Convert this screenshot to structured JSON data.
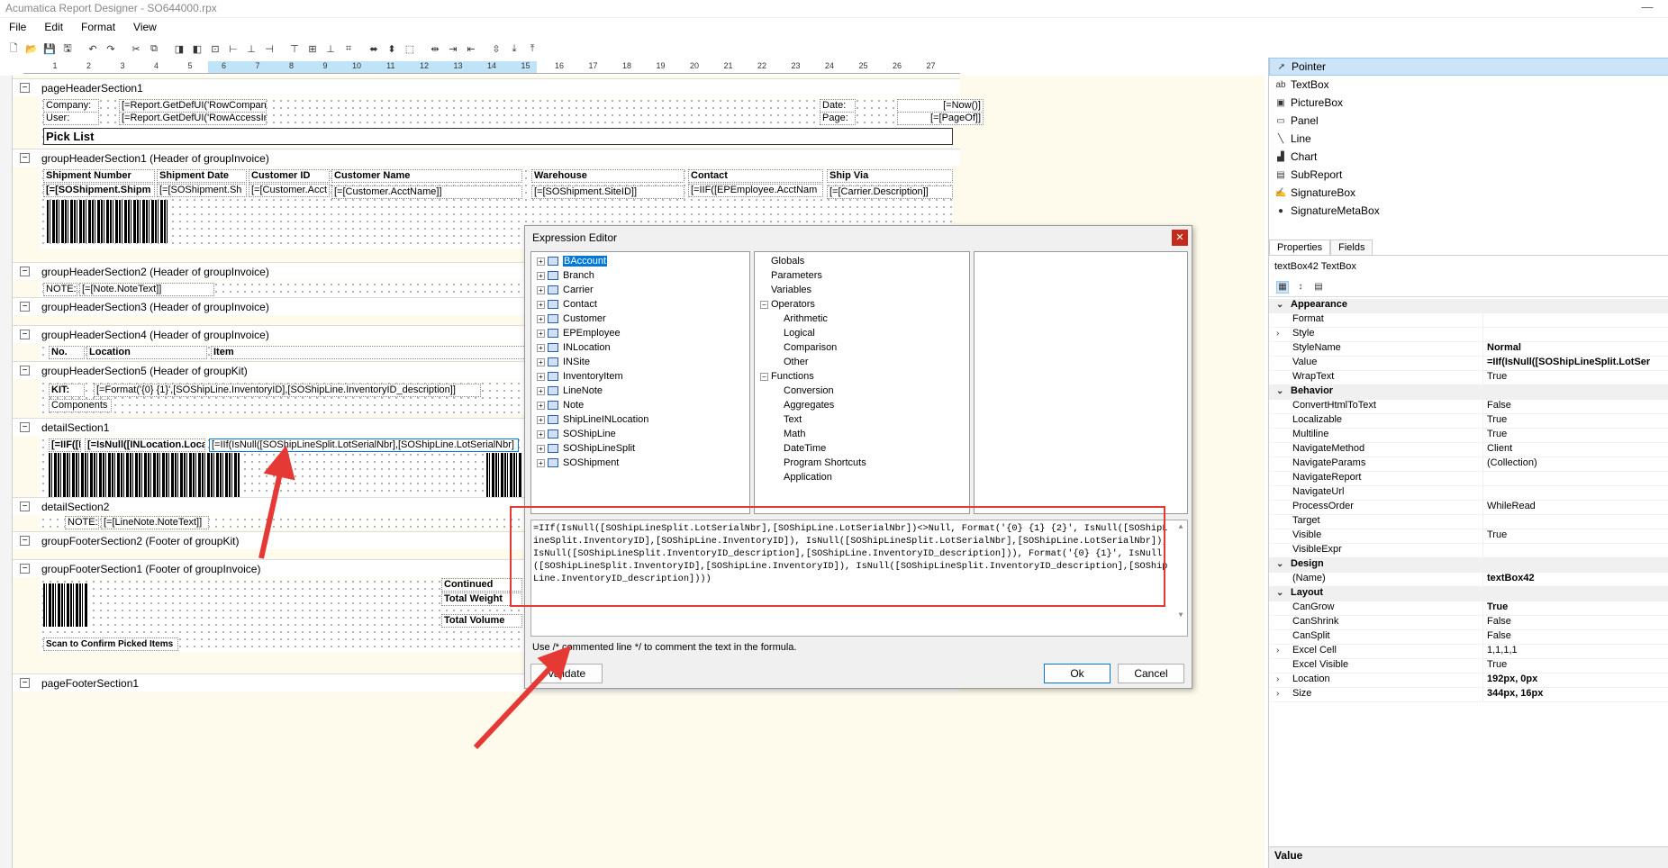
{
  "window": {
    "title": "Acumatica Report Designer - SO644000.rpx"
  },
  "menu": [
    "File",
    "Edit",
    "Format",
    "View"
  ],
  "ruler": [
    "1",
    "2",
    "3",
    "4",
    "5",
    "6",
    "7",
    "8",
    "9",
    "10",
    "11",
    "12",
    "13",
    "14",
    "15",
    "16",
    "17",
    "18",
    "19",
    "20",
    "21",
    "22",
    "23",
    "24",
    "25",
    "26",
    "27"
  ],
  "bands": {
    "ph": "pageHeaderSection1",
    "gh1": "groupHeaderSection1 (Header of groupInvoice)",
    "gh2": "groupHeaderSection2 (Header of groupInvoice)",
    "gh3": "groupHeaderSection3 (Header of groupInvoice)",
    "gh4": "groupHeaderSection4 (Header of groupInvoice)",
    "gh5": "groupHeaderSection5 (Header of groupKit)",
    "d1": "detailSection1",
    "d2": "detailSection2",
    "gf2": "groupFooterSection2 (Footer of groupKit)",
    "gf1": "groupFooterSection1 (Footer of groupInvoice)",
    "pf": "pageFooterSection1"
  },
  "fields": {
    "company": "Company:",
    "company_v": "[=Report.GetDefUI('RowCompan",
    "user": "User:",
    "user_v": "[=Report.GetDefUI('RowAccessIn",
    "date": "Date:",
    "date_v": "[=Now()]",
    "page": "Page:",
    "page_v": "[=[PageOf]]",
    "picklist": "Pick List",
    "h_ship": "Shipment Number",
    "h_date": "Shipment Date",
    "h_cust": "Customer ID",
    "h_cname": "Customer Name",
    "h_wh": "Warehouse",
    "h_contact": "Contact",
    "h_via": "Ship Via",
    "v_ship": "[=[SOShipment.Shipm",
    "v_date": "[=[SOShipment.Sh",
    "v_cust": "[=[Customer.Acct",
    "v_cname": "[=[Customer.AcctName]]",
    "v_wh": "[=[SOShipment.SiteID]]",
    "v_contact": "[=IIF([EPEmployee.AcctNam",
    "v_via": "[=[Carrier.Description]]",
    "note": "NOTE:",
    "note_v": "[=[Note.NoteText]]",
    "no": "No.",
    "loc": "Location",
    "item": "Item",
    "kit": "KIT:",
    "kit_v": "[=Format('{0} {1}',[SOShipLine.InventoryID],[SOShipLine.InventoryID_description]]",
    "components": "Components",
    "d_a": "[=IIF([I",
    "d_b": "[=IsNull([INLocation.Locati",
    "d_c": "[=IIf(IsNull([SOShipLineSplit.LotSerialNbr],[SOShipLine.LotSerialNbr]",
    "note2": "NOTE:",
    "note2_v": "[=[LineNote.NoteText]]",
    "continued": "Continued",
    "tweight": "Total Weight",
    "tvolume": "Total Volume",
    "scan": "Scan to Confirm Picked Items"
  },
  "toolbox": [
    {
      "label": "Pointer",
      "icon": "pointer-icon",
      "glyph": "➚"
    },
    {
      "label": "TextBox",
      "icon": "textbox-icon",
      "glyph": "ab"
    },
    {
      "label": "PictureBox",
      "icon": "picturebox-icon",
      "glyph": "▣"
    },
    {
      "label": "Panel",
      "icon": "panel-icon",
      "glyph": "▭"
    },
    {
      "label": "Line",
      "icon": "line-icon",
      "glyph": "╲"
    },
    {
      "label": "Chart",
      "icon": "chart-icon",
      "glyph": "▟"
    },
    {
      "label": "SubReport",
      "icon": "subreport-icon",
      "glyph": "▤"
    },
    {
      "label": "SignatureBox",
      "icon": "signaturebox-icon",
      "glyph": "✍"
    },
    {
      "label": "SignatureMetaBox",
      "icon": "signaturemetabox-icon",
      "glyph": "●"
    }
  ],
  "props": {
    "tabs": [
      "Properties",
      "Fields"
    ],
    "object": "textBox42 TextBox",
    "rows": [
      {
        "cat": true,
        "name": "Appearance"
      },
      {
        "name": "Format",
        "value": ""
      },
      {
        "name": "Style",
        "value": "",
        "exp": true
      },
      {
        "name": "StyleName",
        "value": "Normal",
        "bold": true
      },
      {
        "name": "Value",
        "value": "=IIf(IsNull([SOShipLineSplit.LotSer",
        "bold": true
      },
      {
        "name": "WrapText",
        "value": "True"
      },
      {
        "cat": true,
        "name": "Behavior"
      },
      {
        "name": "ConvertHtmlToText",
        "value": "False"
      },
      {
        "name": "Localizable",
        "value": "True"
      },
      {
        "name": "Multiline",
        "value": "True"
      },
      {
        "name": "NavigateMethod",
        "value": "Client"
      },
      {
        "name": "NavigateParams",
        "value": "(Collection)"
      },
      {
        "name": "NavigateReport",
        "value": ""
      },
      {
        "name": "NavigateUrl",
        "value": ""
      },
      {
        "name": "ProcessOrder",
        "value": "WhileRead"
      },
      {
        "name": "Target",
        "value": ""
      },
      {
        "name": "Visible",
        "value": "True"
      },
      {
        "name": "VisibleExpr",
        "value": ""
      },
      {
        "cat": true,
        "name": "Design"
      },
      {
        "name": "(Name)",
        "value": "textBox42",
        "bold": true
      },
      {
        "cat": true,
        "name": "Layout"
      },
      {
        "name": "CanGrow",
        "value": "True",
        "bold": true
      },
      {
        "name": "CanShrink",
        "value": "False"
      },
      {
        "name": "CanSplit",
        "value": "False"
      },
      {
        "name": "Excel Cell",
        "value": "1,1,1,1",
        "exp": true
      },
      {
        "name": "Excel Visible",
        "value": "True"
      },
      {
        "name": "Location",
        "value": "192px, 0px",
        "bold": true,
        "exp": true
      },
      {
        "name": "Size",
        "value": "344px, 16px",
        "bold": true,
        "exp": true
      }
    ],
    "desc": "Value"
  },
  "dialog": {
    "title": "Expression Editor",
    "tables": [
      "BAccount",
      "Branch",
      "Carrier",
      "Contact",
      "Customer",
      "EPEmployee",
      "INLocation",
      "INSite",
      "InventoryItem",
      "LineNote",
      "Note",
      "ShipLineINLocation",
      "SOShipLine",
      "SOShipLineSplit",
      "SOShipment"
    ],
    "tree": [
      {
        "label": "Globals",
        "level": 0
      },
      {
        "label": "Parameters",
        "level": 0
      },
      {
        "label": "Variables",
        "level": 0
      },
      {
        "label": "Operators",
        "level": 0,
        "box": "−"
      },
      {
        "label": "Arithmetic",
        "level": 1
      },
      {
        "label": "Logical",
        "level": 1
      },
      {
        "label": "Comparison",
        "level": 1
      },
      {
        "label": "Other",
        "level": 1
      },
      {
        "label": "Functions",
        "level": 0,
        "box": "−"
      },
      {
        "label": "Conversion",
        "level": 1
      },
      {
        "label": "Aggregates",
        "level": 1
      },
      {
        "label": "Text",
        "level": 1
      },
      {
        "label": "Math",
        "level": 1
      },
      {
        "label": "DateTime",
        "level": 1
      },
      {
        "label": "Program Shortcuts",
        "level": 1
      },
      {
        "label": "Application",
        "level": 1
      }
    ],
    "expression": "=IIf(IsNull([SOShipLineSplit.LotSerialNbr],[SOShipLine.LotSerialNbr])<>Null, Format('{0} {1} {2}', IsNull([SOShipLineSplit.InventoryID],[SOShipLine.InventoryID]), IsNull([SOShipLineSplit.LotSerialNbr],[SOShipLine.LotSerialNbr]),IsNull([SOShipLineSplit.InventoryID_description],[SOShipLine.InventoryID_description])), Format('{0} {1}', IsNull([SOShipLineSplit.InventoryID],[SOShipLine.InventoryID]), IsNull([SOShipLineSplit.InventoryID_description],[SOShipLine.InventoryID_description])))",
    "hint": "Use /* commented line */ to comment the text in the formula.",
    "validate": "Validate",
    "ok": "Ok",
    "cancel": "Cancel"
  },
  "colors": {
    "accent": "#0078d7",
    "highlight": "#e53935",
    "canvas": "#fffbec"
  }
}
